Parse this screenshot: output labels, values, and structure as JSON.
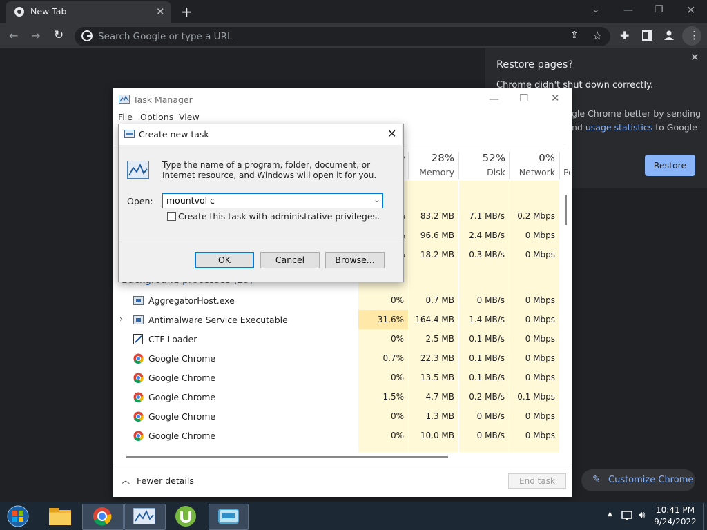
{
  "browser": {
    "tab_title": "New Tab",
    "omnibox_placeholder": "Search Google or type a URL",
    "restore": {
      "title": "Restore pages?",
      "message": "Chrome didn't shut down correctly.",
      "partial_line1": "gle Chrome better by sending",
      "partial_line2_prefix": "nd ",
      "partial_line2_link": "usage statistics",
      "partial_line2_suffix": " to Google",
      "button": "Restore"
    },
    "customize_label": "Customize Chrome",
    "colors": {
      "link": "#8ab4f8",
      "frame": "#202124"
    }
  },
  "task_manager": {
    "title": "Task Manager",
    "menu": [
      "File",
      "Options",
      "View"
    ],
    "columns": [
      {
        "pct": "28%",
        "label": "Memory"
      },
      {
        "pct": "52%",
        "label": "Disk"
      },
      {
        "pct": "0%",
        "label": "Network"
      }
    ],
    "cpu_partial_pct": "%",
    "col_partial": "Po",
    "top_rows": [
      {
        "cpu": "%",
        "memory": "83.2 MB",
        "disk": "7.1 MB/s",
        "network": "0.2 Mbps"
      },
      {
        "cpu": "%",
        "memory": "96.6 MB",
        "disk": "2.4 MB/s",
        "network": "0 Mbps"
      },
      {
        "cpu": "%",
        "memory": "18.2 MB",
        "disk": "0.3 MB/s",
        "network": "0 Mbps"
      }
    ],
    "group_label": "Background processes (29)",
    "processes": [
      {
        "name": "AggregatorHost.exe",
        "cpu": "0%",
        "memory": "0.7 MB",
        "disk": "0 MB/s",
        "network": "0 Mbps"
      },
      {
        "name": "Antimalware Service Executable",
        "cpu": "31.6%",
        "memory": "164.4 MB",
        "disk": "1.4 MB/s",
        "network": "0 Mbps"
      },
      {
        "name": "CTF Loader",
        "cpu": "0%",
        "memory": "2.5 MB",
        "disk": "0.1 MB/s",
        "network": "0 Mbps"
      },
      {
        "name": "Google Chrome",
        "cpu": "0.7%",
        "memory": "22.3 MB",
        "disk": "0.1 MB/s",
        "network": "0 Mbps"
      },
      {
        "name": "Google Chrome",
        "cpu": "0%",
        "memory": "13.5 MB",
        "disk": "0.1 MB/s",
        "network": "0 Mbps"
      },
      {
        "name": "Google Chrome",
        "cpu": "1.5%",
        "memory": "4.7 MB",
        "disk": "0.2 MB/s",
        "network": "0.1 Mbps"
      },
      {
        "name": "Google Chrome",
        "cpu": "0%",
        "memory": "1.3 MB",
        "disk": "0 MB/s",
        "network": "0 Mbps"
      },
      {
        "name": "Google Chrome",
        "cpu": "0%",
        "memory": "10.0 MB",
        "disk": "0 MB/s",
        "network": "0 Mbps"
      }
    ],
    "fewer_details": "Fewer details",
    "end_task": "End task",
    "colors": {
      "cell": "#fff9d8",
      "hot": "#ffe8a8"
    }
  },
  "run_dialog": {
    "title": "Create new task",
    "description": "Type the name of a program, folder, document, or Internet resource, and Windows will open it for you.",
    "open_label": "Open:",
    "input_value": "mountvol c",
    "admin_label": "Create this task with administrative privileges.",
    "admin_checked": false,
    "ok": "OK",
    "cancel": "Cancel",
    "browse": "Browse..."
  },
  "taskbar": {
    "time": "10:41 PM",
    "date": "9/24/2022"
  }
}
